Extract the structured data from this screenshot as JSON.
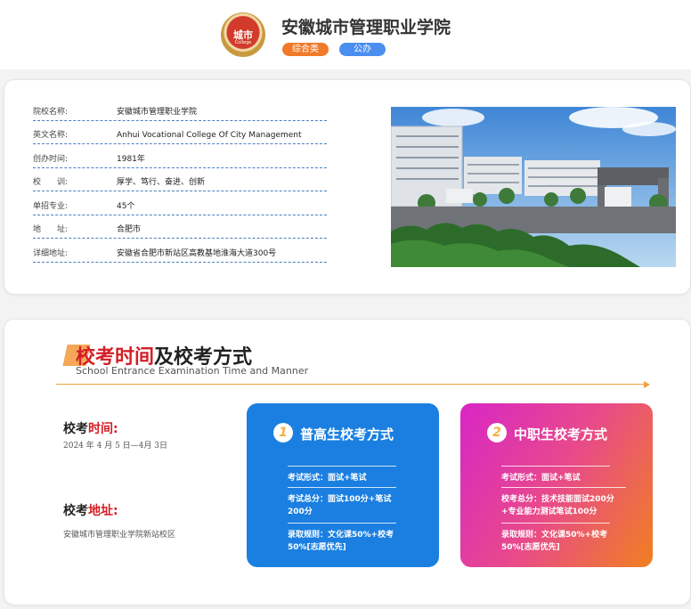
{
  "header": {
    "logo_text": "城市",
    "logo_sub": "College",
    "title": "安徽城市管理职业学院",
    "tags": [
      "综合类",
      "公办"
    ]
  },
  "info": {
    "rows": [
      {
        "label": "院校名称:",
        "value": "安徽城市管理职业学院"
      },
      {
        "label": "英文名称:",
        "value": "Anhui Vocational College Of City Management"
      },
      {
        "label": "创办时间:",
        "value": "1981年"
      },
      {
        "label": "校　　训:",
        "value": "厚学、笃行、奋进、创新"
      },
      {
        "label": "单招专业:",
        "value": "45个"
      },
      {
        "label": "地　　址:",
        "value": "合肥市"
      },
      {
        "label": "详细地址:",
        "value": "安徽省合肥市新站区高教基地淮海大道300号"
      }
    ],
    "photo_alt": "campus-photo"
  },
  "section": {
    "title_red": "校考时间",
    "title_rest": "及校考方式",
    "subtitle": "School Entrance Examination Time and Manner",
    "time_label_a": "校考",
    "time_label_b": "时间:",
    "time_value": "2024 年 4 月 5 日—4月 3日",
    "addr_label_a": "校考",
    "addr_label_b": "地址:",
    "addr_value": "安徽城市管理职业学院新站校区"
  },
  "methods": [
    {
      "num": "1",
      "title": "普高生校考方式",
      "lines": [
        "考试形式：面试+笔试",
        "考试总分：面试100分+笔试200分",
        "录取规则：文化课50%+校考50%[志愿优先]"
      ]
    },
    {
      "num": "2",
      "title": "中职生校考方式",
      "lines": [
        "考试形式：面试+笔试",
        "校考总分：技术技能面试200分+专业能力测试笔试100分",
        "录取规则：文化课50%+校考50%[志愿优先]"
      ]
    }
  ],
  "colors": {
    "accent_red": "#d31f26",
    "tag_orange": "#f07a2a",
    "tag_blue": "#4a8ff0",
    "card_blue": "#1a7fe0",
    "card_pink_start": "#d826c6",
    "card_pink_end": "#f08020"
  }
}
